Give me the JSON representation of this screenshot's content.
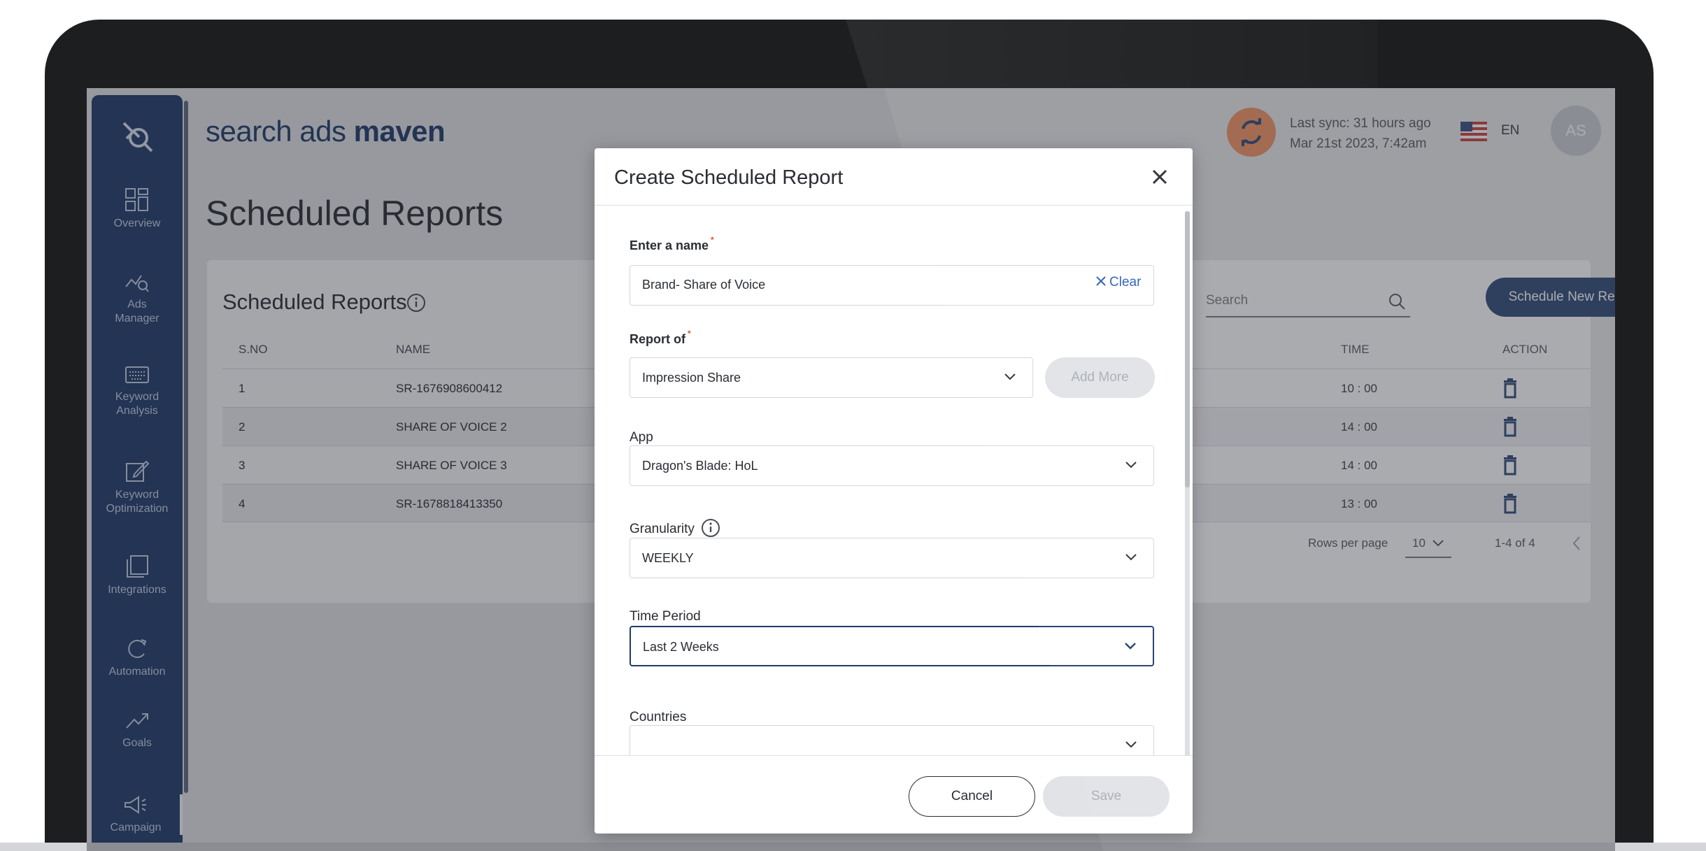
{
  "app": {
    "brand_light": "search ads ",
    "brand_bold": "maven",
    "page_title": "Scheduled Reports"
  },
  "header": {
    "sync_line1": "Last sync: 31 hours ago",
    "sync_line2": "Mar 21st 2023, 7:42am",
    "language": "EN",
    "avatar_initials": "AS"
  },
  "sidebar": {
    "items": [
      {
        "label": "Overview",
        "icon": "grid-icon"
      },
      {
        "label": "Ads\nManager",
        "icon": "chart-search-icon"
      },
      {
        "label": "Keyword\nAnalysis",
        "icon": "keyboard-icon"
      },
      {
        "label": "Keyword\nOptimization",
        "icon": "edit-icon"
      },
      {
        "label": "Integrations",
        "icon": "layers-icon"
      },
      {
        "label": "Automation",
        "icon": "refresh-icon"
      },
      {
        "label": "Goals",
        "icon": "trend-icon"
      },
      {
        "label": "Campaign",
        "icon": "megaphone-icon"
      }
    ]
  },
  "card": {
    "title": "Scheduled Reports",
    "search_placeholder": "Search",
    "schedule_button": "Schedule New Report",
    "columns": {
      "sno": "S.NO",
      "name": "NAME",
      "time": "TIME",
      "action": "ACTION"
    },
    "rows": [
      {
        "sno": "1",
        "name": "SR-1676908600412",
        "time": "10 : 00"
      },
      {
        "sno": "2",
        "name": "SHARE OF VOICE 2",
        "time": "14 : 00"
      },
      {
        "sno": "3",
        "name": "SHARE OF VOICE 3",
        "time": "14 : 00"
      },
      {
        "sno": "4",
        "name": "SR-1678818413350",
        "time": "13 : 00"
      }
    ],
    "pagination": {
      "rows_per_page_label": "Rows per page",
      "rows_per_page": "10",
      "range": "1-4 of 4"
    }
  },
  "modal": {
    "title": "Create Scheduled Report",
    "name_label": "Enter a name",
    "name_value": "Brand- Share of Voice",
    "report_of_label": "Report of",
    "report_of_value": "Impression Share",
    "clear_label": "Clear",
    "add_more_label": "Add More",
    "app_label": "App",
    "app_value": "Dragon's Blade: HoL",
    "granularity_label": "Granularity",
    "granularity_value": "WEEKLY",
    "time_period_label": "Time Period",
    "time_period_value": "Last 2 Weeks",
    "countries_label": "Countries",
    "countries_value": "",
    "cancel_label": "Cancel",
    "save_label": "Save"
  },
  "colors": {
    "primary": "#1f3b6c",
    "accent_orange": "#f28a57",
    "required": "#e04b3c",
    "link": "#2b5cb8"
  }
}
